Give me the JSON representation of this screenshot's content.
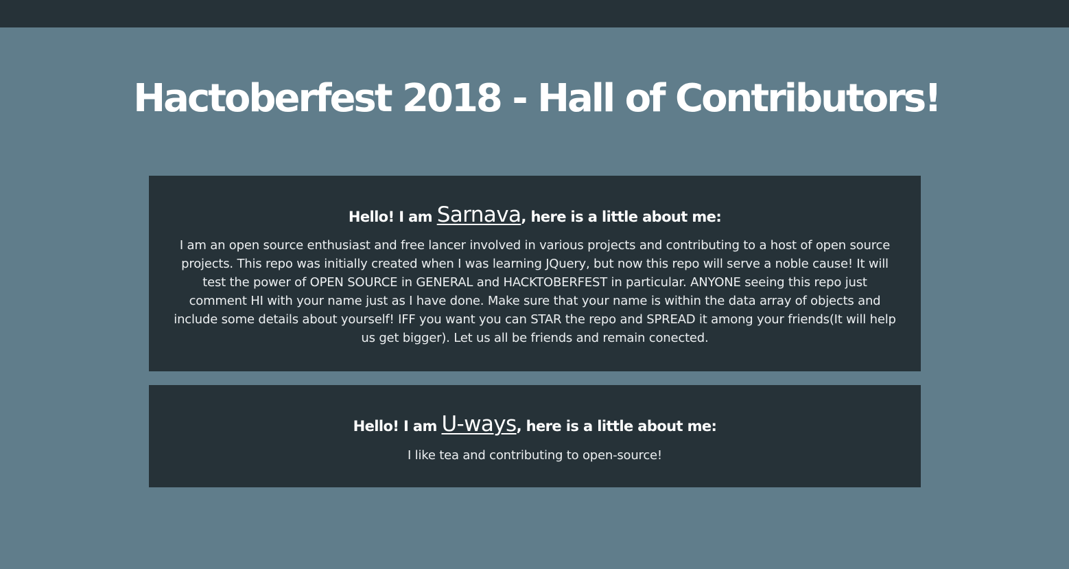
{
  "colors": {
    "page_background": "#607d8b",
    "topbar_background": "#263238",
    "card_background": "#263238",
    "text": "#ffffff"
  },
  "header": {
    "title": "Hactoberfest 2018 - Hall of Contributors!"
  },
  "contributors": [
    {
      "intro_prefix": "Hello! I am ",
      "name": "Sarnava",
      "intro_suffix": ", here is a little about me:",
      "about": "I am an open source enthusiast and free lancer involved in various projects and contributing to a host of open source projects. This repo was initially created when I was learning JQuery, but now this repo will serve a noble cause! It will test the power of OPEN SOURCE in GENERAL and HACKTOBERFEST in particular. ANYONE seeing this repo just comment HI with your name just as I have done. Make sure that your name is within the data array of objects and include some details about yourself! IFF you want you can STAR the repo and SPREAD it among your friends(It will help us get bigger). Let us all be friends and remain conected."
    },
    {
      "intro_prefix": "Hello! I am ",
      "name": "U-ways",
      "intro_suffix": ", here is a little about me:",
      "about": "I like tea and contributing to open-source!"
    }
  ]
}
